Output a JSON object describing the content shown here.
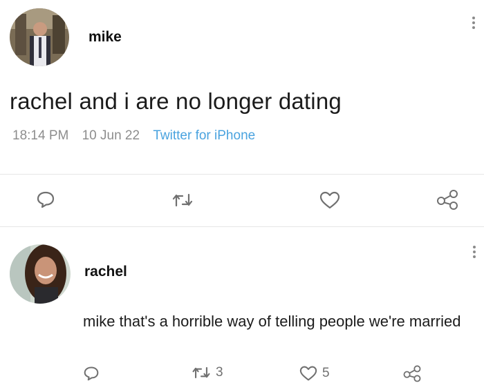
{
  "tweet": {
    "author": "mike",
    "text": "rachel and i are no longer dating",
    "time": "18:14 PM",
    "date": "10 Jun 22",
    "source": "Twitter for iPhone"
  },
  "reply": {
    "author": "rachel",
    "text": "mike that's a horrible way of telling people we're married",
    "retweets": "3",
    "likes": "5"
  },
  "icons": {
    "reply": "comment-icon",
    "retweet": "retweet-icon",
    "like": "heart-icon",
    "share": "share-icon",
    "more": "more-vertical-icon"
  },
  "colors": {
    "source_link": "#4aa3df",
    "meta_text": "#8d8d8d",
    "icon": "#707070"
  }
}
